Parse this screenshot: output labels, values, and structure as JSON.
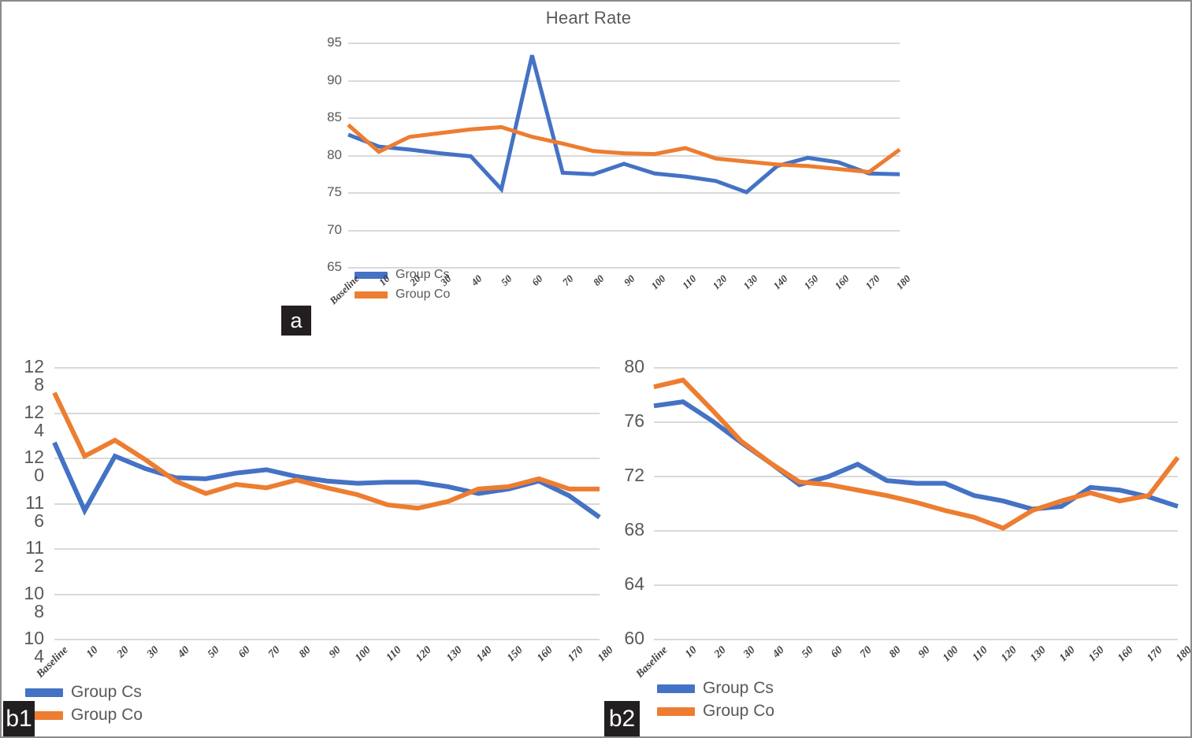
{
  "figure": {
    "background": "#ffffff",
    "border_color": "#8a8a8a",
    "colors": {
      "group_cs": "#4472C4",
      "group_co": "#ED7D31",
      "grid": "#d9d9d9",
      "text": "#595959",
      "badge_bg": "#231f20"
    }
  },
  "panels": [
    {
      "id": "a",
      "badge": "a"
    },
    {
      "id": "b1",
      "badge": "b1"
    },
    {
      "id": "b2",
      "badge": "b2"
    }
  ],
  "legend": {
    "cs_label": "Group Cs",
    "co_label": "Group Co"
  },
  "chart_data": [
    {
      "id": "a",
      "type": "line",
      "title": "Heart Rate",
      "xlabel": "",
      "ylabel": "",
      "ylim": [
        65,
        95
      ],
      "yticks": [
        95,
        90,
        85,
        80,
        75,
        70,
        65
      ],
      "grid": true,
      "legend_position": "bottom-left",
      "categories": [
        "Baseline",
        "10",
        "20",
        "30",
        "40",
        "50",
        "60",
        "70",
        "80",
        "90",
        "100",
        "110",
        "120",
        "130",
        "140",
        "150",
        "160",
        "170",
        "180"
      ],
      "series": [
        {
          "name": "Group Cs",
          "color": "#4472C4",
          "values": [
            82.8,
            81.2,
            80.8,
            80.3,
            79.9,
            75.5,
            93.4,
            77.7,
            77.5,
            78.9,
            77.6,
            77.2,
            76.6,
            75.1,
            78.6,
            79.7,
            79.1,
            77.6,
            77.5
          ]
        },
        {
          "name": "Group Co",
          "color": "#ED7D31",
          "values": [
            84.1,
            80.5,
            82.5,
            83.0,
            83.5,
            83.8,
            82.5,
            81.6,
            80.6,
            80.3,
            80.2,
            81.0,
            79.6,
            79.2,
            78.8,
            78.6,
            78.2,
            77.8,
            80.8
          ]
        }
      ]
    },
    {
      "id": "b1",
      "type": "line",
      "title": "",
      "xlabel": "",
      "ylabel": "",
      "ylim": [
        104,
        128
      ],
      "yticks": [
        128,
        124,
        120,
        116,
        112,
        108,
        104
      ],
      "grid": true,
      "legend_position": "bottom-left",
      "categories": [
        "Baseline",
        "10",
        "20",
        "30",
        "40",
        "50",
        "60",
        "70",
        "80",
        "90",
        "100",
        "110",
        "120",
        "130",
        "140",
        "150",
        "160",
        "170",
        "180"
      ],
      "series": [
        {
          "name": "Group Cs",
          "color": "#4472C4",
          "values": [
            121.4,
            115.4,
            120.2,
            119.1,
            118.3,
            118.2,
            118.7,
            119.0,
            118.4,
            118.0,
            117.8,
            117.9,
            117.9,
            117.5,
            116.9,
            117.3,
            118.0,
            116.7,
            114.8
          ]
        },
        {
          "name": "Group Co",
          "color": "#ED7D31",
          "values": [
            125.8,
            120.2,
            121.6,
            119.9,
            118.0,
            116.9,
            117.7,
            117.4,
            118.1,
            117.4,
            116.8,
            115.9,
            115.6,
            116.2,
            117.3,
            117.5,
            118.2,
            117.3,
            117.3
          ]
        }
      ]
    },
    {
      "id": "b2",
      "type": "line",
      "title": "",
      "xlabel": "",
      "ylabel": "",
      "ylim": [
        60,
        80
      ],
      "yticks": [
        80,
        76,
        72,
        68,
        64,
        60
      ],
      "grid": true,
      "legend_position": "bottom-left",
      "categories": [
        "Baseline",
        "10",
        "20",
        "30",
        "40",
        "50",
        "60",
        "70",
        "80",
        "90",
        "100",
        "110",
        "120",
        "130",
        "140",
        "150",
        "160",
        "170",
        "180"
      ],
      "series": [
        {
          "name": "Group Cs",
          "color": "#4472C4",
          "values": [
            77.2,
            77.5,
            76.1,
            74.5,
            73.0,
            71.4,
            72.0,
            72.9,
            71.7,
            71.5,
            71.5,
            70.6,
            70.2,
            69.6,
            69.8,
            71.2,
            71.0,
            70.5,
            69.8
          ]
        },
        {
          "name": "Group Co",
          "color": "#ED7D31",
          "values": [
            78.6,
            79.1,
            76.9,
            74.6,
            73.0,
            71.6,
            71.4,
            71.0,
            70.6,
            70.1,
            69.5,
            69.0,
            68.2,
            69.5,
            70.2,
            70.8,
            70.2,
            70.6,
            73.4
          ]
        }
      ]
    }
  ]
}
